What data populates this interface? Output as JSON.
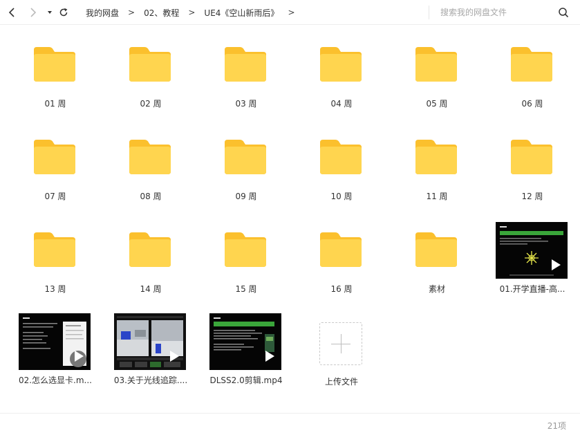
{
  "toolbar": {
    "breadcrumbs": [
      "我的网盘",
      "02、教程",
      "UE4《空山新雨后》"
    ],
    "separator": ">",
    "search_placeholder": "搜索我的网盘文件"
  },
  "items": [
    {
      "label": "01 周",
      "type": "folder"
    },
    {
      "label": "02 周",
      "type": "folder"
    },
    {
      "label": "03 周",
      "type": "folder"
    },
    {
      "label": "04 周",
      "type": "folder"
    },
    {
      "label": "05 周",
      "type": "folder"
    },
    {
      "label": "06 周",
      "type": "folder"
    },
    {
      "label": "07 周",
      "type": "folder"
    },
    {
      "label": "08 周",
      "type": "folder"
    },
    {
      "label": "09 周",
      "type": "folder"
    },
    {
      "label": "10 周",
      "type": "folder"
    },
    {
      "label": "11 周",
      "type": "folder"
    },
    {
      "label": "12 周",
      "type": "folder"
    },
    {
      "label": "13 周",
      "type": "folder"
    },
    {
      "label": "14 周",
      "type": "folder"
    },
    {
      "label": "15 周",
      "type": "folder"
    },
    {
      "label": "16 周",
      "type": "folder"
    },
    {
      "label": "素材",
      "type": "folder"
    },
    {
      "label": "01.开学直播-高...",
      "type": "video"
    },
    {
      "label": "02.怎么选显卡.m...",
      "type": "video"
    },
    {
      "label": "03.关于光线追踪....",
      "type": "video"
    },
    {
      "label": "DLSS2.0剪辑.mp4",
      "type": "video"
    }
  ],
  "upload": {
    "label": "上传文件"
  },
  "footer": {
    "count": "21项"
  },
  "colors": {
    "folder_body": "#FFD54F",
    "folder_tab": "#FBC02D",
    "thumb_green": "#3aa63a"
  }
}
